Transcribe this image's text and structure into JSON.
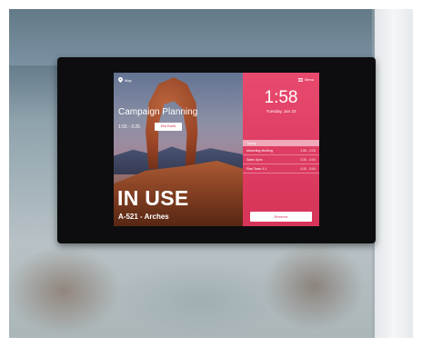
{
  "left_pane": {
    "map_label": "Map",
    "meeting_title": "Campaign Planning",
    "meeting_time": "1:55 - 3:25",
    "end_button": "End Event",
    "status": "IN USE",
    "room": "A-521 - Arches"
  },
  "right_pane": {
    "menu_label": "Menu",
    "clock": "1:58",
    "date": "Tuesday, Jan 23",
    "schedule_header": "Today",
    "events": [
      {
        "title": "Marketing Meeting",
        "time": "1:55 - 3:25"
      },
      {
        "title": "Sales Sync",
        "time": "3:30 - 4:00"
      },
      {
        "title": "Plan Team 1:1",
        "time": "4:30 - 5:00"
      }
    ],
    "reserve_button": "Reserve"
  },
  "colors": {
    "accent": "#e0405f",
    "tablet_bezel": "#0d0d0f"
  },
  "icons": {
    "map": "map-pin-icon",
    "menu": "hamburger-menu-icon"
  }
}
